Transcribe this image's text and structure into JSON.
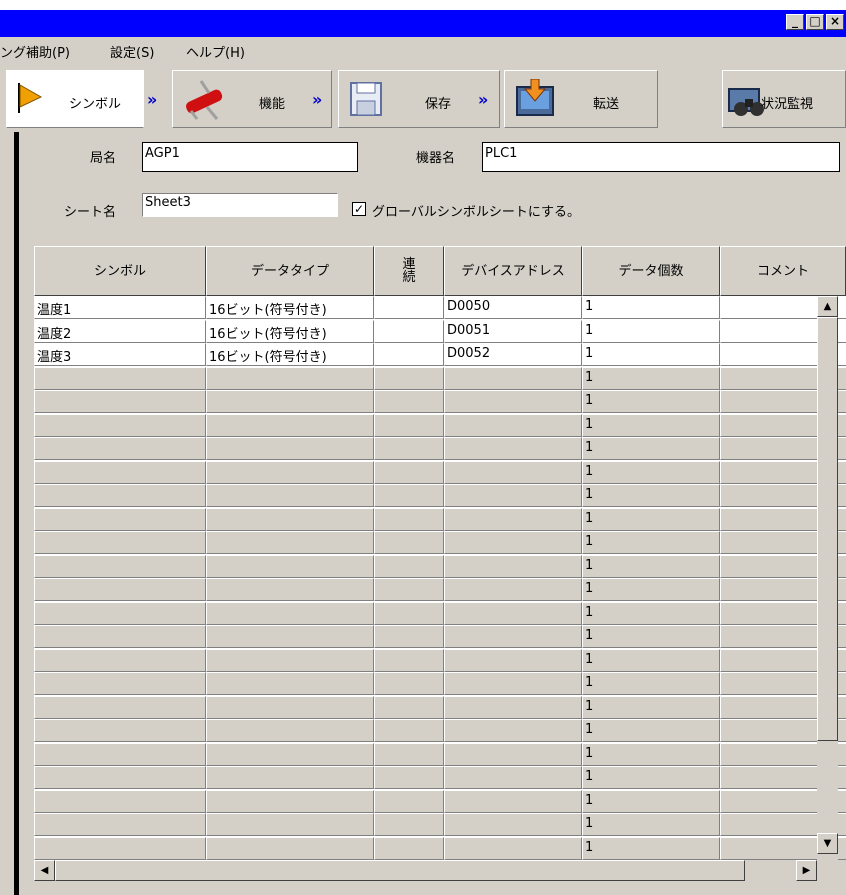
{
  "window": {
    "minimize": "_",
    "maximize": "□",
    "close": "×"
  },
  "menu": [
    "ング補助(P)",
    "設定(S)",
    "ヘルプ(H)"
  ],
  "steps": {
    "symbol": "シンボル",
    "function": "機能",
    "save": "保存",
    "transfer": "転送",
    "monitor": "状況監視"
  },
  "arrows": "»",
  "form": {
    "station_label": "局名",
    "station_value": "AGP1",
    "device_label": "機器名",
    "device_value": "PLC1",
    "sheet_label": "シート名",
    "sheet_value": "Sheet3",
    "global_checked": "✓",
    "global_label": "グローバルシンボルシートにする。"
  },
  "table": {
    "headers": [
      "シンボル",
      "データタイプ",
      "連続",
      "デバイスアドレス",
      "データ個数",
      "コメント"
    ],
    "rows": [
      [
        "温度1",
        "16ビット(符号付き)",
        "",
        "D0050",
        "1",
        ""
      ],
      [
        "温度2",
        "16ビット(符号付き)",
        "",
        "D0051",
        "1",
        ""
      ],
      [
        "温度3",
        "16ビット(符号付き)",
        "",
        "D0052",
        "1",
        ""
      ],
      [
        "",
        "",
        "",
        "",
        "1",
        ""
      ],
      [
        "",
        "",
        "",
        "",
        "1",
        ""
      ],
      [
        "",
        "",
        "",
        "",
        "1",
        ""
      ],
      [
        "",
        "",
        "",
        "",
        "1",
        ""
      ],
      [
        "",
        "",
        "",
        "",
        "1",
        ""
      ],
      [
        "",
        "",
        "",
        "",
        "1",
        ""
      ],
      [
        "",
        "",
        "",
        "",
        "1",
        ""
      ],
      [
        "",
        "",
        "",
        "",
        "1",
        ""
      ],
      [
        "",
        "",
        "",
        "",
        "1",
        ""
      ],
      [
        "",
        "",
        "",
        "",
        "1",
        ""
      ],
      [
        "",
        "",
        "",
        "",
        "1",
        ""
      ],
      [
        "",
        "",
        "",
        "",
        "1",
        ""
      ],
      [
        "",
        "",
        "",
        "",
        "1",
        ""
      ],
      [
        "",
        "",
        "",
        "",
        "1",
        ""
      ],
      [
        "",
        "",
        "",
        "",
        "1",
        ""
      ],
      [
        "",
        "",
        "",
        "",
        "1",
        ""
      ],
      [
        "",
        "",
        "",
        "",
        "1",
        ""
      ],
      [
        "",
        "",
        "",
        "",
        "1",
        ""
      ],
      [
        "",
        "",
        "",
        "",
        "1",
        ""
      ],
      [
        "",
        "",
        "",
        "",
        "1",
        ""
      ],
      [
        "",
        "",
        "",
        "",
        "1",
        ""
      ]
    ]
  },
  "scroll": {
    "up": "▲",
    "down": "▼",
    "left": "◀",
    "right": "▶"
  }
}
